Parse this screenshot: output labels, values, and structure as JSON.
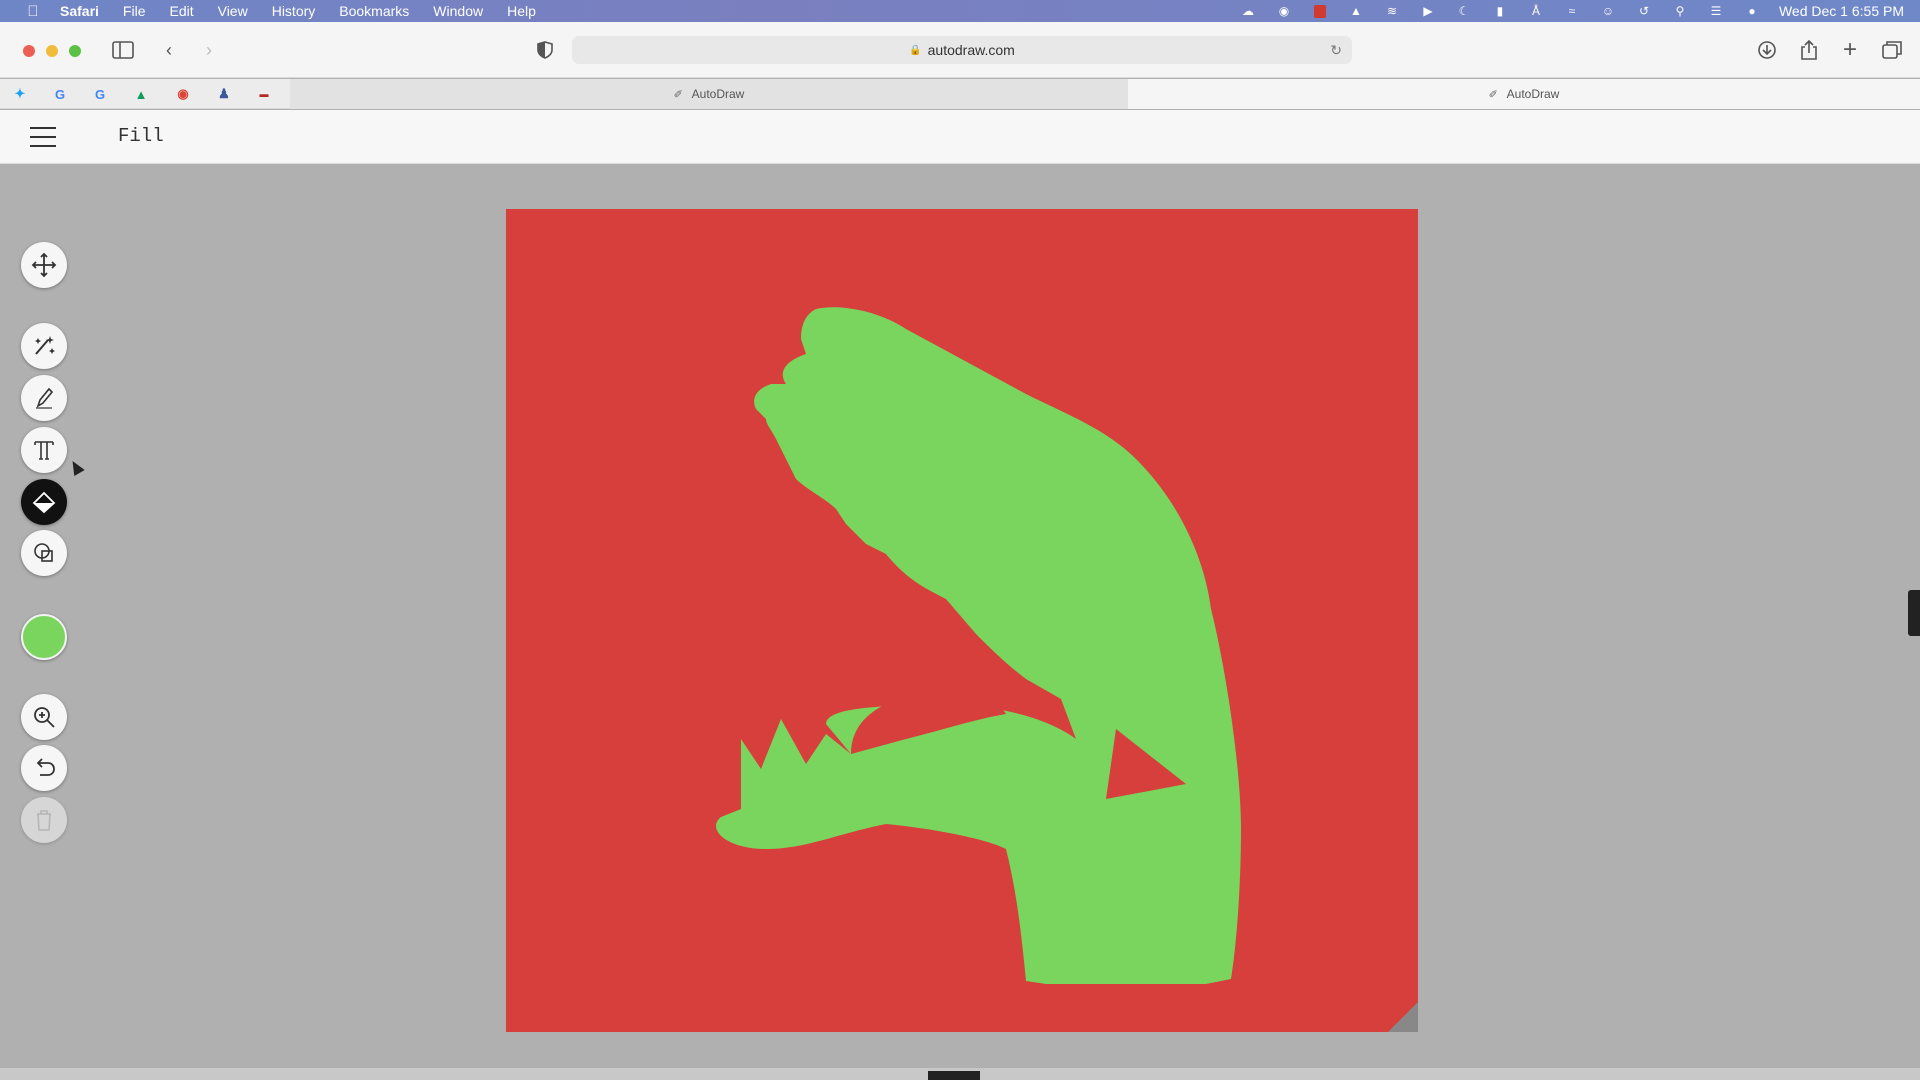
{
  "menubar": {
    "apple_icon": "apple-icon",
    "items": [
      "Safari",
      "File",
      "Edit",
      "View",
      "History",
      "Bookmarks",
      "Window",
      "Help"
    ],
    "status_icons": [
      "cloud-icon",
      "compass-icon",
      "red-app-icon",
      "vlc-icon",
      "cast-icon",
      "play-icon",
      "moon-icon",
      "battery-icon",
      "bluetooth-icon",
      "wifi-icon",
      "user-icon",
      "time-machine-icon",
      "spotlight-icon",
      "control-center-icon",
      "siri-icon"
    ],
    "clock": "Wed Dec 1  6:55 PM"
  },
  "browser": {
    "url": "autodraw.com",
    "tabs": [
      {
        "title": "AutoDraw",
        "active": false
      },
      {
        "title": "AutoDraw",
        "active": true
      }
    ],
    "favorites": [
      "twitter-icon",
      "google-icon",
      "google-icon",
      "drive-icon",
      "chrome-icon",
      "person-icon",
      "ultra-icon",
      "google-icon"
    ]
  },
  "app": {
    "current_tool": "Fill",
    "selected_color": "#79d55e",
    "tools": [
      "move-icon",
      "autodraw-icon",
      "draw-icon",
      "text-icon",
      "fill-icon",
      "shape-icon",
      "color-swatch",
      "zoom-icon",
      "undo-icon",
      "delete-icon"
    ],
    "active_tool": "fill-icon"
  },
  "canvas": {
    "background_color": "#d63f3b",
    "drawing_color": "#79d55e"
  }
}
